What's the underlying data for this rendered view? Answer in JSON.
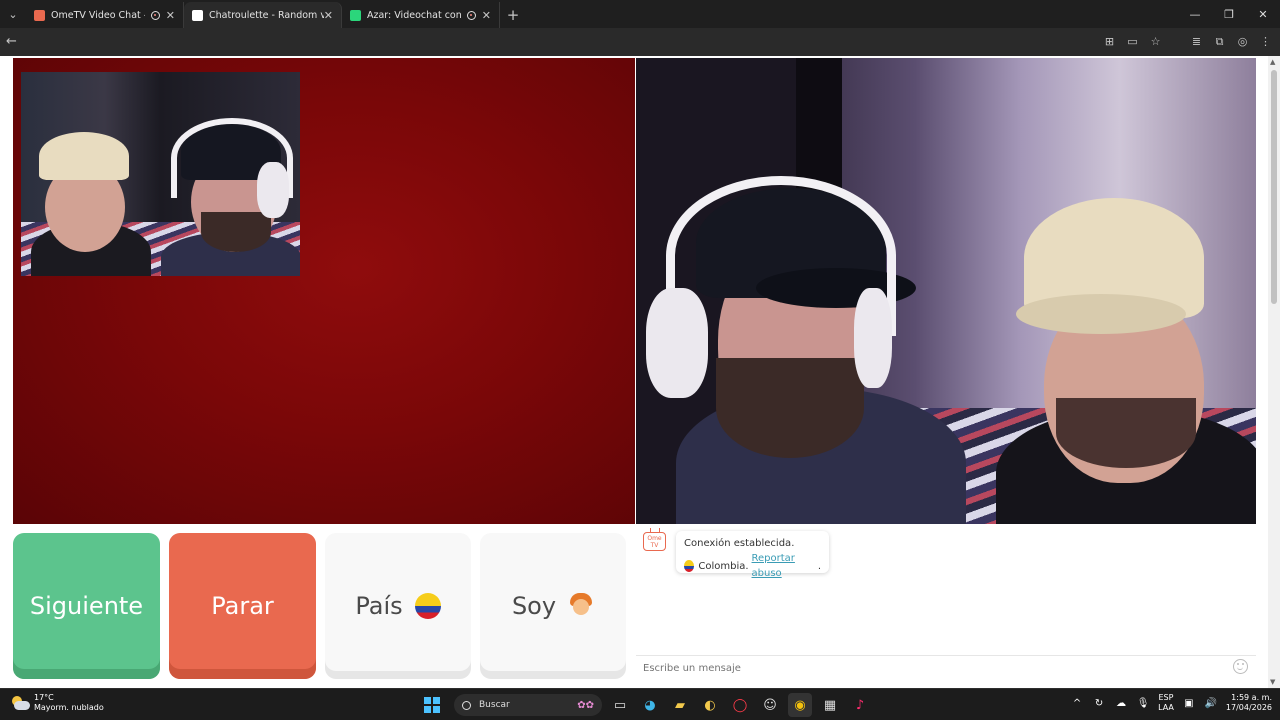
{
  "browser": {
    "tabs": [
      {
        "title": "OmeTV Video Chat — Ome",
        "active": false,
        "favicon_color": "#e9694f"
      },
      {
        "title": "Chatroulette - Random video c",
        "active": true,
        "favicon_color": "#ffffff"
      },
      {
        "title": "Azar: Videochat con gente",
        "active": false,
        "favicon_color": "#2bd67b"
      }
    ],
    "new_tab": "+",
    "window_controls": [
      "—",
      "❐",
      "✕"
    ]
  },
  "controls": {
    "next_label": "Siguiente",
    "stop_label": "Parar",
    "country_label": "País",
    "gender_label": "Soy"
  },
  "chat": {
    "status": "Conexión establecida.",
    "country": "Colombia.",
    "report_link": "Reportar abuso",
    "report_suffix": ".",
    "input_placeholder": "Escribe un mensaje"
  },
  "taskbar": {
    "temperature": "17°C",
    "weather": "Mayorm. nublado",
    "search_placeholder": "Buscar",
    "language_top": "ESP",
    "language_bottom": "LAA",
    "time": "1:59 a. m.",
    "date": "17/04/2026"
  },
  "colors": {
    "next": "#5cc48d",
    "stop": "#e9694f",
    "report_link": "#3a9cb5"
  }
}
